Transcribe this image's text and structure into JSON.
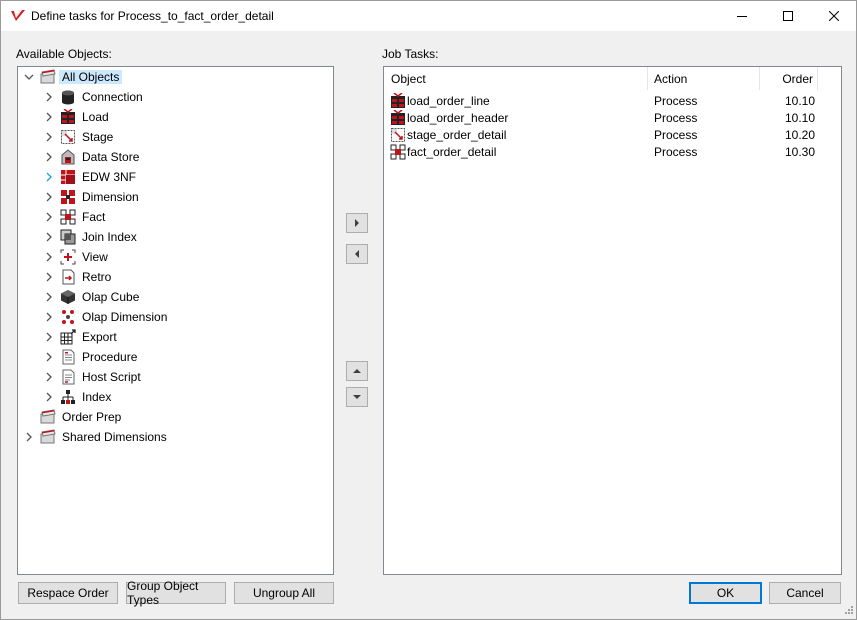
{
  "window": {
    "title": "Define tasks for Process_to_fact_order_detail"
  },
  "available": {
    "label": "Available Objects:",
    "tree": [
      {
        "label": "All Objects",
        "icon": "folder-icon",
        "level": 0,
        "expander": "expanded",
        "selected": true
      },
      {
        "label": "Connection",
        "icon": "database-icon",
        "level": 1,
        "expander": "collapsed"
      },
      {
        "label": "Load",
        "icon": "load-table-icon",
        "level": 1,
        "expander": "collapsed"
      },
      {
        "label": "Stage",
        "icon": "stage-table-icon",
        "level": 1,
        "expander": "collapsed"
      },
      {
        "label": "Data Store",
        "icon": "data-store-icon",
        "level": 1,
        "expander": "collapsed"
      },
      {
        "label": "EDW 3NF",
        "icon": "edw-3nf-icon",
        "level": 1,
        "expander": "collapsed-hover"
      },
      {
        "label": "Dimension",
        "icon": "dimension-icon",
        "level": 1,
        "expander": "collapsed"
      },
      {
        "label": "Fact",
        "icon": "fact-icon",
        "level": 1,
        "expander": "collapsed"
      },
      {
        "label": "Join Index",
        "icon": "join-index-icon",
        "level": 1,
        "expander": "collapsed"
      },
      {
        "label": "View",
        "icon": "view-icon",
        "level": 1,
        "expander": "collapsed"
      },
      {
        "label": "Retro",
        "icon": "retro-icon",
        "level": 1,
        "expander": "collapsed"
      },
      {
        "label": "Olap Cube",
        "icon": "olap-cube-icon",
        "level": 1,
        "expander": "collapsed"
      },
      {
        "label": "Olap Dimension",
        "icon": "olap-dimension-icon",
        "level": 1,
        "expander": "collapsed"
      },
      {
        "label": "Export",
        "icon": "export-icon",
        "level": 1,
        "expander": "collapsed"
      },
      {
        "label": "Procedure",
        "icon": "procedure-icon",
        "level": 1,
        "expander": "collapsed"
      },
      {
        "label": "Host Script",
        "icon": "host-script-icon",
        "level": 1,
        "expander": "collapsed"
      },
      {
        "label": "Index",
        "icon": "index-icon",
        "level": 1,
        "expander": "collapsed"
      },
      {
        "label": "Order Prep",
        "icon": "folder-icon",
        "level": 0,
        "expander": "none"
      },
      {
        "label": "Shared Dimensions",
        "icon": "folder-icon",
        "level": 0,
        "expander": "collapsed"
      }
    ]
  },
  "tasks": {
    "label": "Job Tasks:",
    "columns": {
      "object": "Object",
      "action": "Action",
      "order": "Order"
    },
    "rows": [
      {
        "object": "load_order_line",
        "action": "Process",
        "order": "10.10",
        "icon": "load-table-icon"
      },
      {
        "object": "load_order_header",
        "action": "Process",
        "order": "10.10",
        "icon": "load-table-icon"
      },
      {
        "object": "stage_order_detail",
        "action": "Process",
        "order": "10.20",
        "icon": "stage-table-icon"
      },
      {
        "object": "fact_order_detail",
        "action": "Process",
        "order": "10.30",
        "icon": "fact-icon"
      }
    ]
  },
  "buttons": {
    "respace_order": "Respace Order",
    "group_object_types": "Group Object Types",
    "ungroup_all": "Ungroup All",
    "ok": "OK",
    "cancel": "Cancel"
  },
  "colors": {
    "selection": "#cce8ff",
    "accent": "#0078d7",
    "icon_red": "#c0141c"
  }
}
